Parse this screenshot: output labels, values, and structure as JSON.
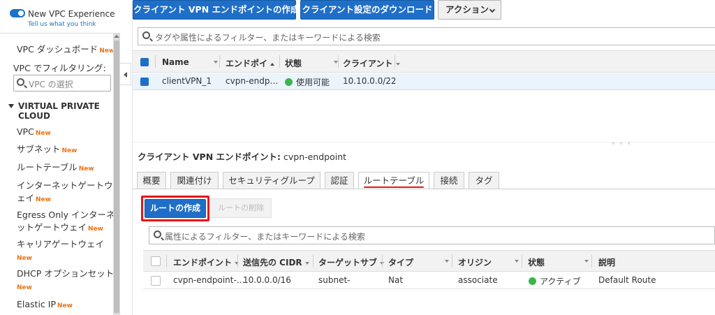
{
  "sidebar": {
    "experience_label": "New VPC Experience",
    "tell_us": "Tell us what you think",
    "new_badge": "New",
    "dashboard": "VPC ダッシュボード",
    "filter_label": "VPC でフィルタリング:",
    "filter_placeholder": "VPC の選択",
    "section": "VIRTUAL PRIVATE CLOUD",
    "items": [
      {
        "label": "VPC",
        "is_new": true
      },
      {
        "label": "サブネット",
        "is_new": true
      },
      {
        "label": "ルートテーブル",
        "is_new": true
      },
      {
        "label_line1": "インターネットゲートウ",
        "label_line2": "ェイ",
        "is_new": true
      },
      {
        "label_line1": "Egress Only インターネ",
        "label_line2": "ットゲートウェイ",
        "is_new": true
      },
      {
        "label_line1": "キャリアゲートウェイ",
        "is_new": true
      },
      {
        "label_line1": "DHCP オプションセット",
        "is_new": true
      },
      {
        "label": "Elastic IP",
        "is_new": true
      }
    ]
  },
  "toolbar": {
    "create_endpoint": "クライアント VPN エンドポイントの作成",
    "download_config": "クライアント設定のダウンロード",
    "actions": "アクション"
  },
  "search": {
    "placeholder": "タグや属性によるフィルター、またはキーワードによる検索"
  },
  "endpoints_table": {
    "columns": [
      "Name",
      "エンドポイ",
      "状態",
      "クライアント"
    ],
    "rows": [
      {
        "name": "clientVPN_1",
        "endpoint": "cvpn-endp…",
        "status": "使用可能",
        "client": "10.10.0.0/22"
      }
    ]
  },
  "details": {
    "title_label": "クライアント VPN エンドポイント:",
    "title_value": "cvpn-endpoint",
    "split_handle": "˚ ˚ ˚",
    "tabs": [
      "概要",
      "関連付け",
      "セキュリティグループ",
      "認証",
      "ルートテーブル",
      "接続",
      "タグ"
    ],
    "active_tab": "ルートテーブル",
    "create_route": "ルートの作成",
    "delete_route": "ルートの削除",
    "filter_placeholder": "属性によるフィルター、またはキーワードによる検索"
  },
  "routes_table": {
    "columns": [
      "エンドポイント",
      "送信先の CIDR",
      "ターゲットサブ",
      "タイプ",
      "オリジン",
      "状態",
      "説明"
    ],
    "rows": [
      {
        "endpoint": "cvpn-endpoint-…",
        "cidr": "10.0.0.0/16",
        "target": "subnet-",
        "type": "Nat",
        "origin": "associate",
        "status": "アクティブ",
        "description": "Default Route"
      }
    ]
  },
  "colors": {
    "primary_blue": "#1f6fc8",
    "new_orange": "#ec7211",
    "status_green": "#3cb54a",
    "highlight_red": "#e8151b"
  }
}
